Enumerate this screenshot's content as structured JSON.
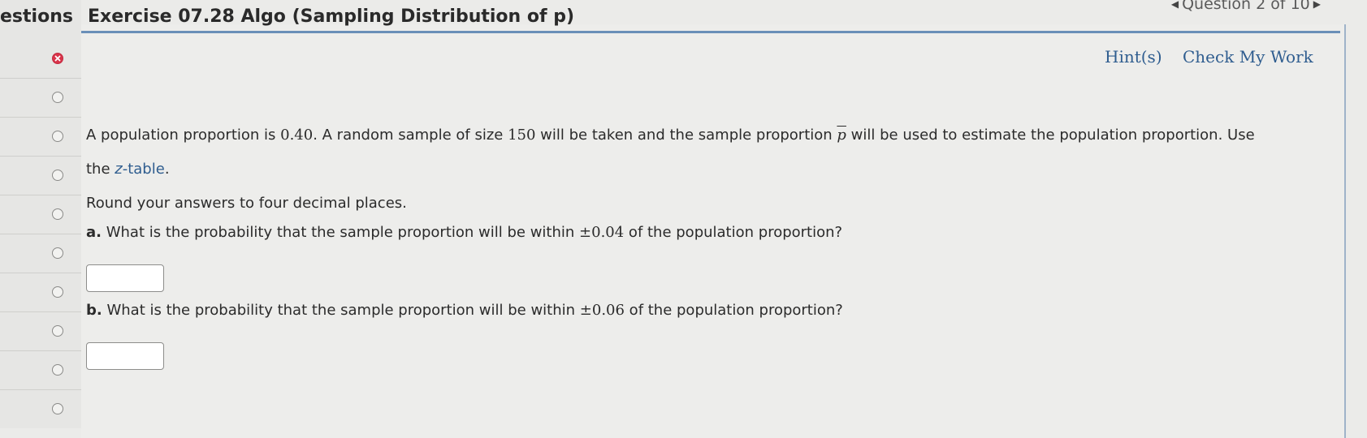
{
  "sidebar": {
    "title": "estions",
    "questions": [
      {
        "status": "wrong"
      },
      {
        "status": "unanswered"
      },
      {
        "status": "unanswered"
      },
      {
        "status": "unanswered"
      },
      {
        "status": "unanswered"
      },
      {
        "status": "unanswered"
      },
      {
        "status": "unanswered"
      },
      {
        "status": "unanswered"
      },
      {
        "status": "unanswered"
      },
      {
        "status": "unanswered"
      }
    ]
  },
  "header": {
    "title": "Exercise 07.28 Algo (Sampling Distribution of p)",
    "question_nav": "Question 2 of 10",
    "accent_color": "#6a8fb8"
  },
  "links": {
    "hints": "Hint(s)",
    "check": "Check My Work",
    "link_color": "#2f5d8f"
  },
  "problem": {
    "line1_a": "A population proportion is ",
    "proportion": "0.40",
    "line1_b": ". A random sample of size ",
    "sample_size": "150",
    "line1_c": " will be taken and the sample proportion ",
    "symbol": "p",
    "line1_d": " will be used to estimate the population proportion. Use",
    "line2_a": "the ",
    "ztable_z": "z",
    "ztable_rest": "-table",
    "line2_b": ".",
    "instruction": "Round your answers to four decimal places.",
    "parts": [
      {
        "label": "a.",
        "text_a": " What is the probability that the sample proportion will be within ",
        "value": "±0.04",
        "text_b": " of the population proportion?",
        "answer": ""
      },
      {
        "label": "b.",
        "text_a": " What is the probability that the sample proportion will be within ",
        "value": "±0.06",
        "text_b": " of the population proportion?",
        "answer": ""
      }
    ]
  }
}
